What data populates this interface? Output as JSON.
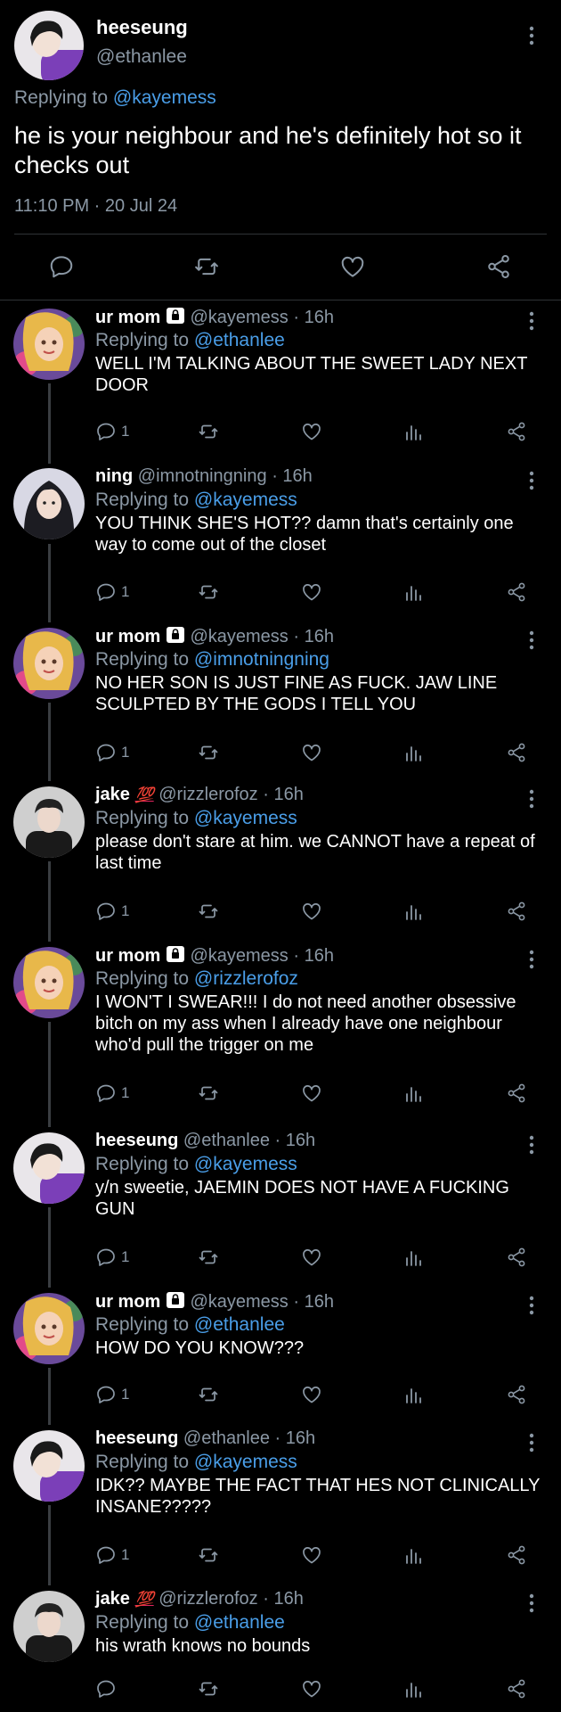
{
  "main_tweet": {
    "name": "heeseung",
    "handle": "@ethanlee",
    "replying_prefix": "Replying to ",
    "replying_to": "@kayemess",
    "text": "he is your neighbour and he's definitely hot so it checks out",
    "timestamp": "11:10 PM · 20 Jul 24"
  },
  "replies": [
    {
      "name": "ur mom",
      "badge": "lock",
      "handle": "@kayemess",
      "time": "· 16h",
      "replying_prefix": "Replying to ",
      "replying_to": "@ethanlee",
      "text": "WELL I'M TALKING ABOUT THE SWEET LADY NEXT DOOR",
      "reply_count": "1"
    },
    {
      "name": "ning",
      "badge": "",
      "handle": "@imnotningning",
      "time": "· 16h",
      "replying_prefix": "Replying to ",
      "replying_to": "@kayemess",
      "text": "YOU THINK SHE'S HOT?? damn that's certainly one way to come out of the closet",
      "reply_count": "1"
    },
    {
      "name": "ur mom",
      "badge": "lock",
      "handle": "@kayemess",
      "time": "· 16h",
      "replying_prefix": "Replying to ",
      "replying_to": "@imnotningning",
      "text": "NO HER SON IS JUST FINE AS FUCK. JAW LINE SCULPTED BY THE GODS I TELL YOU",
      "reply_count": "1"
    },
    {
      "name": "jake",
      "badge": "💯",
      "handle": "@rizzlerofoz",
      "time": "· 16h",
      "replying_prefix": "Replying to ",
      "replying_to": "@kayemess",
      "text": "please don't stare at him. we CANNOT have a repeat of last time",
      "reply_count": "1"
    },
    {
      "name": "ur mom",
      "badge": "lock",
      "handle": "@kayemess",
      "time": "· 16h",
      "replying_prefix": "Replying to ",
      "replying_to": "@rizzlerofoz",
      "text": "I WON'T I SWEAR!!! I do not need another obsessive bitch on my ass when I already have one neighbour who'd pull the trigger on me",
      "reply_count": "1"
    },
    {
      "name": "heeseung",
      "badge": "",
      "handle": "@ethanlee",
      "time": "· 16h",
      "replying_prefix": "Replying to ",
      "replying_to": "@kayemess",
      "text": "y/n sweetie, JAEMIN DOES NOT HAVE A FUCKING GUN",
      "reply_count": "1"
    },
    {
      "name": "ur mom",
      "badge": "lock",
      "handle": "@kayemess",
      "time": "· 16h",
      "replying_prefix": "Replying to ",
      "replying_to": "@ethanlee",
      "text": "HOW DO YOU KNOW???",
      "reply_count": "1"
    },
    {
      "name": "heeseung",
      "badge": "",
      "handle": "@ethanlee",
      "time": "· 16h",
      "replying_prefix": "Replying to ",
      "replying_to": "@kayemess",
      "text": "IDK?? MAYBE THE FACT THAT HES NOT CLINICALLY INSANE?????",
      "reply_count": "1"
    },
    {
      "name": "jake",
      "badge": "💯",
      "handle": "@rizzlerofoz",
      "time": "· 16h",
      "replying_prefix": "Replying to ",
      "replying_to": "@ethanlee",
      "text": "his wrath knows no bounds",
      "reply_count": ""
    }
  ],
  "colors": {
    "background": "#000000",
    "text": "#ffffff",
    "muted": "#8b98a5",
    "mention": "#4a9ee8",
    "thread_line": "#3a3e42",
    "divider": "#2f3336"
  },
  "icons": {
    "more": "more-vertical-icon",
    "reply": "reply-icon",
    "retweet": "retweet-icon",
    "like": "heart-icon",
    "views": "views-icon",
    "share": "share-icon",
    "lock": "lock-icon"
  }
}
